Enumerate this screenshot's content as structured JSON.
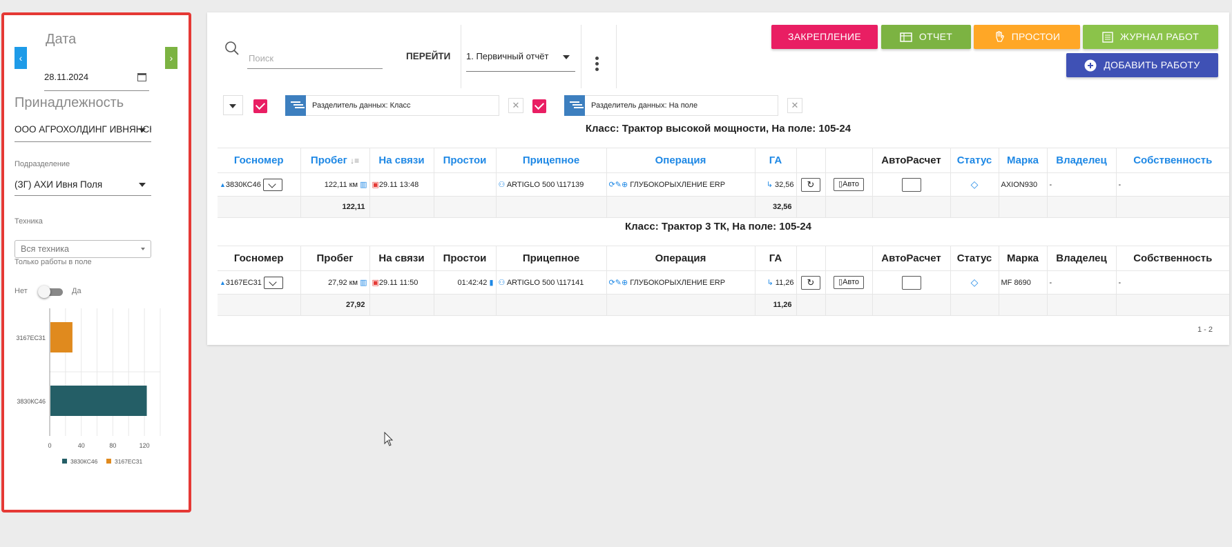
{
  "sidebar": {
    "date_label": "Дата",
    "date_value": "28.11.2024",
    "prev_label": "‹",
    "next_label": "›",
    "ownership_label": "Принадлежность",
    "ownership_value": "ООО АГРОХОЛДИНГ ИВНЯНСКИЙ",
    "division_label": "Подразделение",
    "division_value": "(ЗГ) АХИ Ивня Поля",
    "tech_label": "Техника",
    "tech_placeholder": "Вся техника",
    "field_only_label": "Только работы в поле",
    "toggle_off": "Нет",
    "toggle_on": "Да",
    "accent_color": "#e53935"
  },
  "chart_data": {
    "type": "bar",
    "orientation": "horizontal",
    "categories": [
      "3167ЕС31",
      "3830КС46"
    ],
    "series": [
      {
        "name": "3830КС46",
        "color": "#245e66",
        "values": [
          0,
          122.11
        ]
      },
      {
        "name": "3167ЕС31",
        "color": "#e08a1e",
        "values": [
          27.92,
          0
        ]
      }
    ],
    "xticks": [
      "0",
      "40",
      "80",
      "120"
    ],
    "xlim": [
      0,
      140
    ],
    "grid": true,
    "legend": "bottom"
  },
  "toolbar": {
    "search_placeholder": "Поиск",
    "go_label": "ПЕРЕЙТИ",
    "report_value": "1. Первичный отчёт",
    "btn_zakr": "ЗАКРЕПЛЕНИЕ",
    "btn_otch": "ОТЧЕТ",
    "btn_prost": "ПРОСТОИ",
    "btn_zhurn": "ЖУРНАЛ РАБОТ",
    "btn_add": "ДОБАВИТЬ РАБОТУ",
    "colors": {
      "pink": "#e91e63",
      "green": "#7cb342",
      "orange": "#ffa726",
      "lightgreen": "#8bc34a",
      "indigo": "#3f51b5"
    }
  },
  "filters": {
    "chip1": "Разделитель данных: Класс",
    "chip2": "Разделитель данных: На поле"
  },
  "columns": [
    "Госномер",
    "Пробег",
    "На связи",
    "Простои",
    "Прицепное",
    "Операция",
    "ГА",
    "",
    "",
    "АвтоРасчет",
    "Статус",
    "Марка",
    "Владелец",
    "Собственность"
  ],
  "sort_indicator": "↓≡",
  "groups": [
    {
      "title": "Класс: Трактор высокой мощности, На поле: 105-24",
      "row": {
        "gosnomer": "3830КС46",
        "probeg": "122,11 км",
        "na_svyazi": "29.11 13:48",
        "prostoi": "",
        "pricepnoe": "ARTIGLO 500 \\117139",
        "operation": "ГЛУБОКОРЫХЛЕНИЕ ERP",
        "ga": "32,56",
        "auto": "Авто",
        "marka": "AXION930",
        "vladelec": "-",
        "sobstv": "-"
      },
      "sum": {
        "probeg": "122,11",
        "ga": "32,56"
      }
    },
    {
      "title": "Класс: Трактор 3 ТК, На поле: 105-24",
      "row": {
        "gosnomer": "3167ЕС31",
        "probeg": "27,92 км",
        "na_svyazi": "29.11 11:50",
        "prostoi": "01:42:42",
        "pricepnoe": "ARTIGLO 500 \\117141",
        "operation": "ГЛУБОКОРЫХЛЕНИЕ ERP",
        "ga": "11,26",
        "auto": "Авто",
        "marka": "MF 8690",
        "vladelec": "-",
        "sobstv": "-"
      },
      "sum": {
        "probeg": "27,92",
        "ga": "11,26"
      }
    }
  ],
  "pager": "1 - 2"
}
